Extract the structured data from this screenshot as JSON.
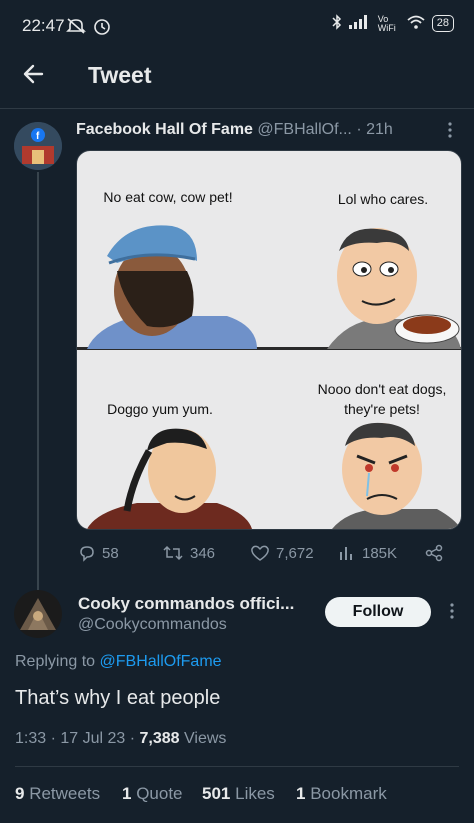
{
  "status": {
    "time": "22:47",
    "network": "Vo WiFi",
    "battery": "28"
  },
  "header": {
    "title": "Tweet"
  },
  "tweet": {
    "author_name": "Facebook Hall Of Fame",
    "author_handle": "@FBHallOf...",
    "age": "· 21h",
    "meme": {
      "panel1_left": "No eat cow, cow pet!",
      "panel1_right": "Lol who cares.",
      "panel2_left": "Doggo yum yum.",
      "panel2_right": "Nooo don't eat dogs, they're pets!"
    },
    "replies": "58",
    "retweets": "346",
    "likes": "7,672",
    "views": "185K"
  },
  "reply": {
    "author_name": "Cooky commandos offici...",
    "author_handle": "@Cookycommandos",
    "follow_label": "Follow",
    "replying_prefix": "Replying to",
    "replying_to": "@FBHallOfFame",
    "text": "That’s why I eat people",
    "timestamp": "1:33 · 17 Jul 23 ·",
    "view_count": "7,388",
    "views_label": "Views"
  },
  "stats": {
    "retweets_count": "9",
    "retweets_label": "Retweets",
    "quotes_count": "1",
    "quotes_label": "Quote",
    "likes_count": "501",
    "likes_label": "Likes",
    "bookmarks_count": "1",
    "bookmarks_label": "Bookmark"
  },
  "colors": {
    "background": "#15202b",
    "accent": "#1d9bf0",
    "muted": "#8b98a5"
  }
}
